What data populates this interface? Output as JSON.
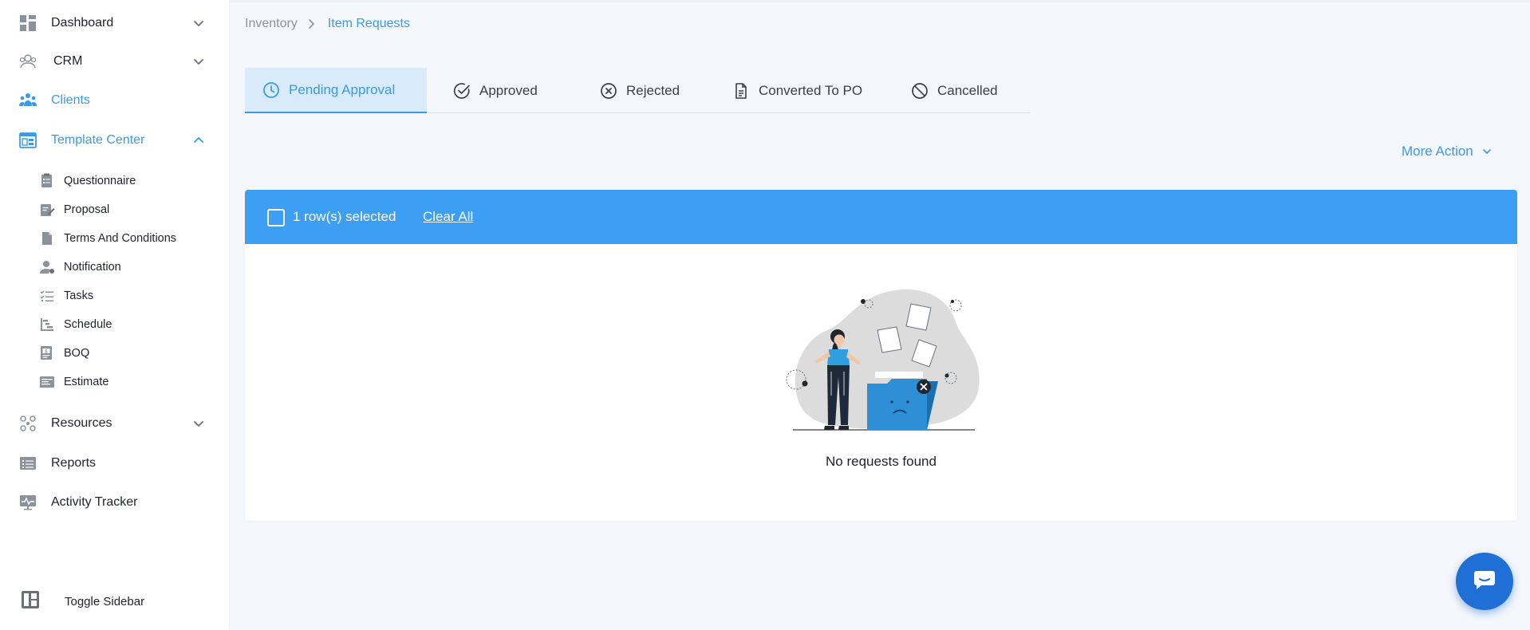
{
  "sidebar": {
    "items": [
      {
        "label": "Dashboard",
        "icon": "dashboard-icon",
        "expandable": true,
        "expanded": false
      },
      {
        "label": "CRM",
        "icon": "crm-icon",
        "expandable": true,
        "expanded": false
      },
      {
        "label": "Clients",
        "icon": "clients-icon",
        "expandable": false,
        "active": true
      },
      {
        "label": "Template Center",
        "icon": "template-center-icon",
        "expandable": true,
        "expanded": true,
        "active": true
      },
      {
        "label": "Resources",
        "icon": "resources-icon",
        "expandable": true,
        "expanded": false
      },
      {
        "label": "Reports",
        "icon": "reports-icon",
        "expandable": false
      },
      {
        "label": "Activity Tracker",
        "icon": "activity-tracker-icon",
        "expandable": false
      }
    ],
    "template_center_children": [
      {
        "label": "Questionnaire",
        "icon": "questionnaire-icon"
      },
      {
        "label": "Proposal",
        "icon": "proposal-icon"
      },
      {
        "label": "Terms And Conditions",
        "icon": "document-icon"
      },
      {
        "label": "Notification",
        "icon": "user-notification-icon"
      },
      {
        "label": "Tasks",
        "icon": "tasks-list-icon"
      },
      {
        "label": "Schedule",
        "icon": "schedule-icon"
      },
      {
        "label": "BOQ",
        "icon": "boq-icon"
      },
      {
        "label": "Estimate",
        "icon": "estimate-icon"
      }
    ],
    "toggle_label": "Toggle Sidebar"
  },
  "breadcrumb": {
    "root": "Inventory",
    "current": "Item Requests"
  },
  "tabs": [
    {
      "label": "Pending Approval",
      "icon": "clock-icon",
      "active": true
    },
    {
      "label": "Approved",
      "icon": "check-circle-icon",
      "active": false
    },
    {
      "label": "Rejected",
      "icon": "x-circle-icon",
      "active": false
    },
    {
      "label": "Converted To PO",
      "icon": "document-icon",
      "active": false
    },
    {
      "label": "Cancelled",
      "icon": "ban-icon",
      "active": false
    }
  ],
  "toolbar": {
    "more_action_label": "More Action"
  },
  "selection": {
    "count_text": "1 row(s) selected",
    "clear_label": "Clear All"
  },
  "empty_state": {
    "message": "No requests found",
    "illustration": "empty-folder-illustration"
  },
  "chat": {
    "icon": "chat-icon"
  },
  "colors": {
    "accent": "#3a9ae8",
    "selection_bar": "#3d9ff3",
    "active_tab_bg": "#d9ebfa",
    "chat_button": "#1f6fd6",
    "page_bg": "#f4f7fb"
  }
}
